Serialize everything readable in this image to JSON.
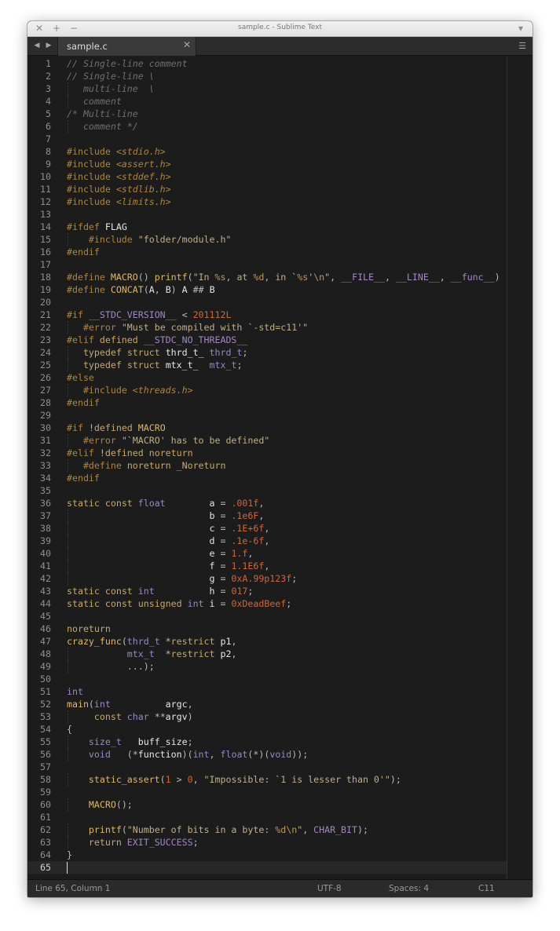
{
  "window": {
    "title": "sample.c - Sublime Text",
    "tab_label": "sample.c",
    "colors": {
      "background": "#1c1c1c",
      "comment": "#6f6f6f",
      "preprocessor": "#b0843d",
      "keyword": "#c9a86a",
      "string": "#c0b089",
      "number": "#d0653c",
      "macro": "#a387c5"
    }
  },
  "titlebar": {
    "close_icon": "✕",
    "maximize_icon": "+",
    "minimize_icon": "−",
    "dropdown_icon": "▾"
  },
  "tabbar": {
    "back_icon": "◀",
    "forward_icon": "▶",
    "close_icon": "✕",
    "menu_icon": "☰"
  },
  "editor": {
    "current_line": 65,
    "lines": [
      "// Single-line comment",
      "// Single-line \\",
      "   multi-line  \\",
      "   comment",
      "/* Multi-line",
      "   comment */",
      "",
      "#include <stdio.h>",
      "#include <assert.h>",
      "#include <stddef.h>",
      "#include <stdlib.h>",
      "#include <limits.h>",
      "",
      "#ifdef FLAG",
      "    #include \"folder/module.h\"",
      "#endif",
      "",
      "#define MACRO() printf(\"In %s, at %d, in `%s'\\n\", __FILE__, __LINE__, __func__)",
      "#define CONCAT(A, B) A ## B",
      "",
      "#if __STDC_VERSION__ < 201112L",
      "   #error \"Must be compiled with `-std=c11'\"",
      "#elif defined __STDC_NO_THREADS__",
      "   typedef struct thrd_t_ thrd_t;",
      "   typedef struct mtx_t_  mtx_t;",
      "#else",
      "   #include <threads.h>",
      "#endif",
      "",
      "#if !defined MACRO",
      "   #error \"`MACRO' has to be defined\"",
      "#elif !defined noreturn",
      "   #define noreturn _Noreturn",
      "#endif",
      "",
      "static const float        a = .001f,",
      "                          b = .1e6F,",
      "                          c = .1E+6f,",
      "                          d = .1e-6f,",
      "                          e = 1.f,",
      "                          f = 1.1E6f,",
      "                          g = 0xA.99p123f;",
      "static const int          h = 017;",
      "static const unsigned int i = 0xDeadBeef;",
      "",
      "noreturn",
      "crazy_func(thrd_t *restrict p1,",
      "           mtx_t  *restrict p2,",
      "           ...);",
      "",
      "int",
      "main(int          argc,",
      "     const char **argv)",
      "{",
      "    size_t   buff_size;",
      "    void   (*function)(int, float(*)(void));",
      "",
      "    static_assert(1 > 0, \"Impossible: `1 is lesser than 0'\");",
      "",
      "    MACRO();",
      "",
      "    printf(\"Number of bits in a byte: %d\\n\", CHAR_BIT);",
      "    return EXIT_SUCCESS;",
      "}",
      ""
    ]
  },
  "statusbar": {
    "position": "Line 65, Column 1",
    "encoding": "UTF-8",
    "indentation": "Spaces: 4",
    "syntax": "C11"
  }
}
